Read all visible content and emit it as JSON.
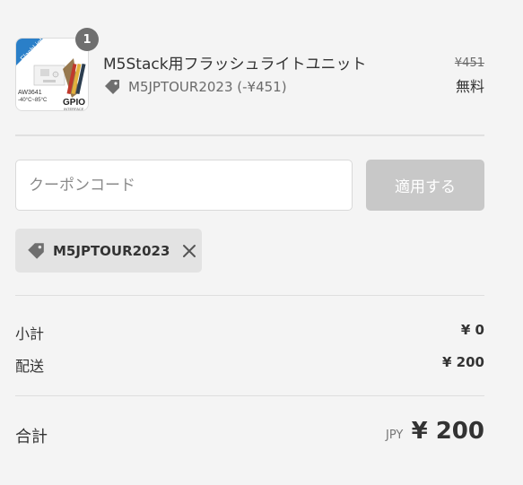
{
  "line_item": {
    "quantity": "1",
    "title": "M5Stack用フラッシュライトユニット",
    "discount_text": "M5JPTOUR2023 (-¥451)",
    "original_price": "¥451",
    "price": "無料",
    "thumbnail": {
      "brand": "FlashLight",
      "chip": "AW3641",
      "temp": "-40°C~85°C",
      "port": "GPIO",
      "port_sub": "INTERFACE"
    }
  },
  "coupon": {
    "placeholder": "クーポンコード",
    "apply_label": "適用する",
    "applied_code": "M5JPTOUR2023"
  },
  "summary": {
    "subtotal_label": "小計",
    "subtotal_value": "¥ 0",
    "shipping_label": "配送",
    "shipping_value": "¥ 200",
    "total_label": "合計",
    "currency": "JPY",
    "total_value": "¥ 200"
  },
  "colors": {
    "background": "#f4f4f4",
    "badge": "#6f6f6f",
    "apply_button_disabled": "#c8c8c8",
    "applied_tag_bg": "#e3e3e3"
  },
  "icons": [
    "discount-tag-icon",
    "close-icon"
  ]
}
